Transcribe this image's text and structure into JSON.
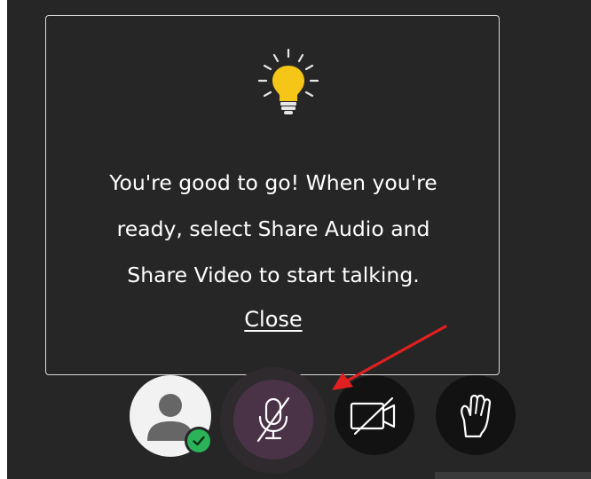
{
  "tooltip": {
    "message_line1": "You're good to go! When you're",
    "message_line2": "ready, select Share Audio and",
    "message_line3": "Share Video to start talking.",
    "close_label": "Close"
  },
  "icons": {
    "tooltip": "lightbulb-icon",
    "avatar": "user-avatar-icon",
    "badge": "checkmark-icon",
    "audio": "microphone-muted-icon",
    "video": "camera-off-icon",
    "hand": "raise-hand-icon",
    "annotation": "red-arrow-icon"
  },
  "colors": {
    "background": "#262626",
    "bulb": "#f5c518",
    "status_ok": "#2bb35a",
    "mic_active": "#4a3346",
    "arrow": "#e02020"
  }
}
